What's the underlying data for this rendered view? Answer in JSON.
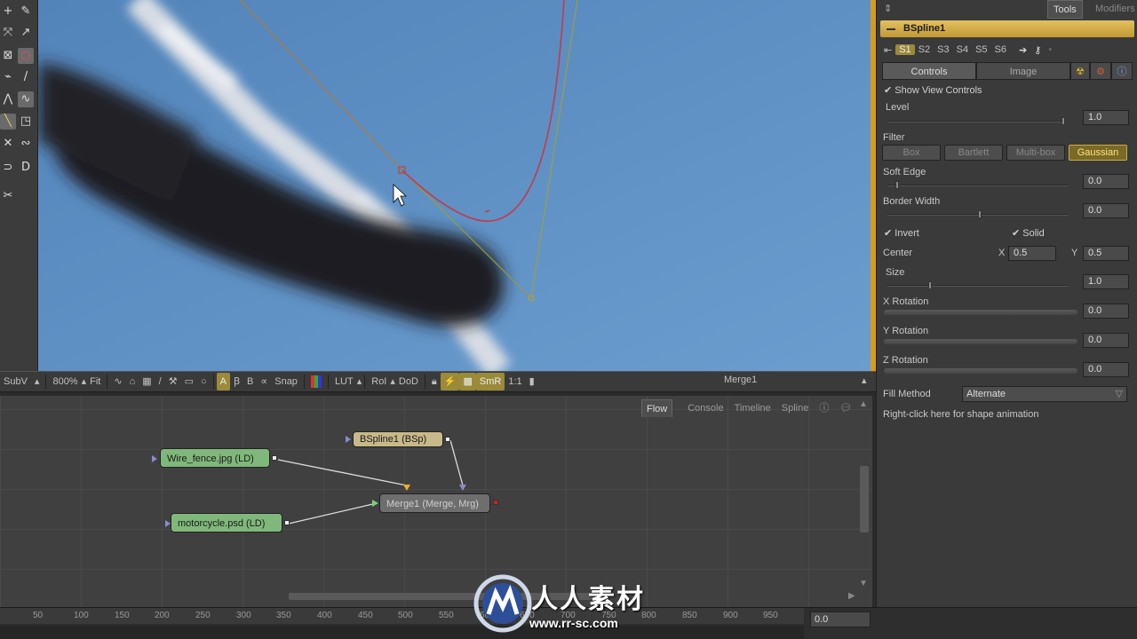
{
  "viewer_toolbar": {
    "subv": "SubV",
    "zoom": "800%",
    "fit": "Fit",
    "snap": "Snap",
    "lut": "LUT",
    "roi": "RoI",
    "dod": "DoD",
    "smr": "SmR",
    "one_to_one": "1:1",
    "view_title": "Merge1"
  },
  "flow": {
    "tabs": [
      "Flow",
      "Console",
      "Timeline",
      "Spline"
    ],
    "active_tab": "Flow",
    "nodes": {
      "wire_fence": "Wire_fence.jpg  (LD)",
      "motorcycle": "motorcycle.psd  (LD)",
      "bspline": "BSpline1  (BSp)",
      "merge": "Merge1  (Merge, Mrg)"
    },
    "colors": {
      "loader": "#7fb87a",
      "bspline": "#c8b98a",
      "merge": "#6e6e6e",
      "accent": "#d89a1c"
    }
  },
  "timeline": {
    "ticks": [
      "50",
      "100",
      "150",
      "200",
      "250",
      "300",
      "350",
      "400",
      "450",
      "500",
      "550",
      "600",
      "650",
      "700",
      "750",
      "800",
      "850",
      "900",
      "950"
    ],
    "current_time": "0.0"
  },
  "panel": {
    "tabs": {
      "tools": "Tools",
      "modifiers": "Modifiers"
    },
    "tool_name": "BSpline1",
    "shapes": [
      "S1",
      "S2",
      "S3",
      "S4",
      "S5",
      "S6"
    ],
    "control_tabs": {
      "controls": "Controls",
      "image": "Image"
    },
    "show_view_controls": "Show View Controls",
    "level": {
      "label": "Level",
      "value": "1.0"
    },
    "filter": {
      "label": "Filter",
      "options": [
        "Box",
        "Bartlett",
        "Multi-box",
        "Gaussian"
      ],
      "selected": "Gaussian"
    },
    "soft_edge": {
      "label": "Soft Edge",
      "value": "0.0"
    },
    "border_width": {
      "label": "Border Width",
      "value": "0.0"
    },
    "invert": "Invert",
    "solid": "Solid",
    "center": {
      "label": "Center",
      "x_label": "X",
      "x": "0.5",
      "y_label": "Y",
      "y": "0.5"
    },
    "size": {
      "label": "Size",
      "value": "1.0"
    },
    "x_rotation": {
      "label": "X Rotation",
      "value": "0.0"
    },
    "y_rotation": {
      "label": "Y Rotation",
      "value": "0.0"
    },
    "z_rotation": {
      "label": "Z Rotation",
      "value": "0.0"
    },
    "fill_method": {
      "label": "Fill Method",
      "value": "Alternate"
    },
    "hint": "Right-click here for shape animation"
  },
  "watermark": {
    "text": "人人素材",
    "url": "www.rr-sc.com"
  }
}
